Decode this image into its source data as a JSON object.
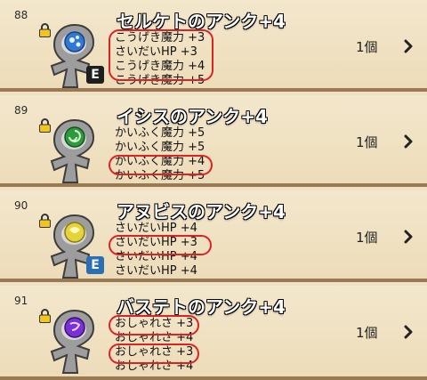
{
  "rows": [
    {
      "number": "88",
      "title": "セルケトのアンク+4",
      "stats": [
        "こうげき魔力 +3",
        "さいだいHP +3",
        "こうげき魔力 +4",
        "こうげき魔力 +5"
      ],
      "count": "1個",
      "gem_color": "#2f78d6",
      "badge": "E"
    },
    {
      "number": "89",
      "title": "イシスのアンク+4",
      "stats": [
        "かいふく魔力 +5",
        "かいふく魔力 +5",
        "かいふく魔力 +4",
        "かいふく魔力 +5"
      ],
      "count": "1個",
      "gem_color": "#2e9a3e",
      "badge": ""
    },
    {
      "number": "90",
      "title": "アヌビスのアンク+4",
      "stats": [
        "さいだいHP +4",
        "さいだいHP +3",
        "さいだいHP +4",
        "さいだいHP +4"
      ],
      "count": "1個",
      "gem_color": "#e3d43a",
      "badge": "E"
    },
    {
      "number": "91",
      "title": "バステトのアンク+4",
      "stats": [
        "おしゃれさ +3",
        "おしゃれさ +4",
        "おしゃれさ +3",
        "おしゃれさ +4"
      ],
      "count": "1個",
      "gem_color": "#7b2fd6",
      "badge": ""
    }
  ],
  "colors": {
    "parchment": "#efe2c4",
    "separator": "#9a7a53",
    "highlight_circle": "#dd2222"
  },
  "icons": [
    "lock-icon",
    "ankh-icon",
    "equipped-badge-icon",
    "chevron-right-icon"
  ]
}
